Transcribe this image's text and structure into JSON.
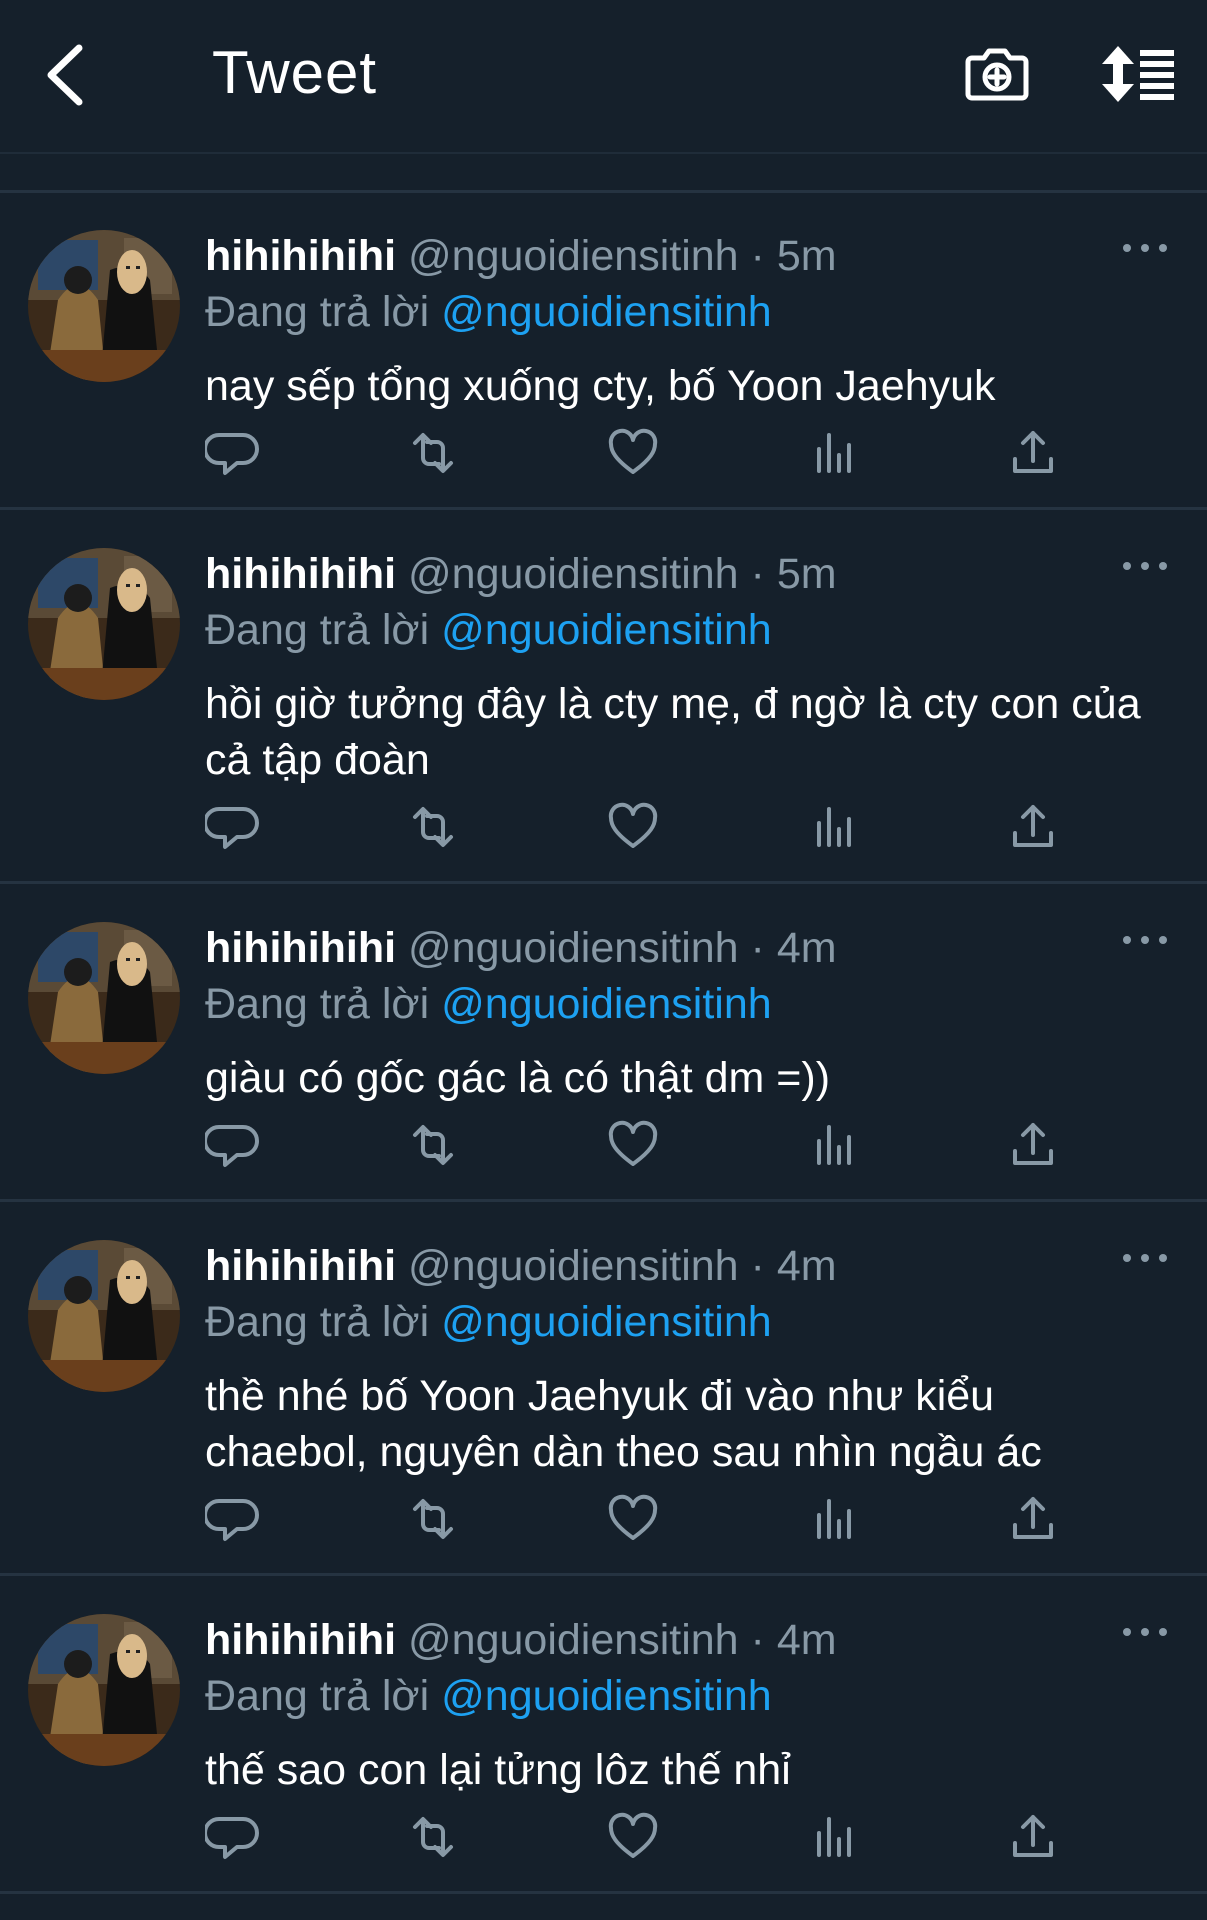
{
  "header": {
    "title": "Tweet",
    "icons": [
      "back-arrow-icon",
      "camera-add-icon",
      "sort-icon"
    ]
  },
  "colors": {
    "background": "#15202b",
    "divider": "#253341",
    "secondary_text": "#8899a6",
    "accent": "#1da1f2"
  },
  "tweets": [
    {
      "name": "hihihihihi",
      "handle": "@nguoidiensitinh",
      "dot": "·",
      "time": "5m",
      "reply_prefix": "Đang trả lời",
      "reply_to": "@nguoidiensitinh",
      "text": "nay sếp tổng xuống cty, bố Yoon Jaehyuk"
    },
    {
      "name": "hihihihihi",
      "handle": "@nguoidiensitinh",
      "dot": "·",
      "time": "5m",
      "reply_prefix": "Đang trả lời",
      "reply_to": "@nguoidiensitinh",
      "text": "hồi giờ tưởng đây là cty mẹ, đ ngờ là cty con của cả tập đoàn"
    },
    {
      "name": "hihihihihi",
      "handle": "@nguoidiensitinh",
      "dot": "·",
      "time": "4m",
      "reply_prefix": "Đang trả lời",
      "reply_to": "@nguoidiensitinh",
      "text": "giàu có gốc gác là có thật dm =))"
    },
    {
      "name": "hihihihihi",
      "handle": "@nguoidiensitinh",
      "dot": "·",
      "time": "4m",
      "reply_prefix": "Đang trả lời",
      "reply_to": "@nguoidiensitinh",
      "text": "thề nhé bố Yoon Jaehyuk đi vào như kiểu chaebol, nguyên dàn theo sau nhìn ngầu ác"
    },
    {
      "name": "hihihihihi",
      "handle": "@nguoidiensitinh",
      "dot": "·",
      "time": "4m",
      "reply_prefix": "Đang trả lời",
      "reply_to": "@nguoidiensitinh",
      "text": "thế sao con lại tửng lôz thế nhỉ"
    }
  ]
}
